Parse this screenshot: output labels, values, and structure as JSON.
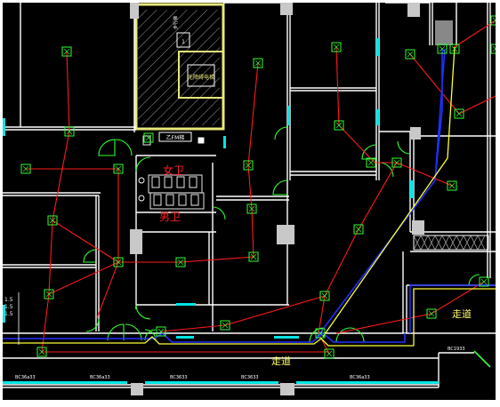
{
  "drawing": {
    "label_wc_female": "女卫",
    "label_wc_male": "男卫",
    "label_corridor_right": "走道",
    "label_corridor_bottom": "走道",
    "label_elevator": "无障碍电梯",
    "label_stair_top": "步行梯",
    "label_stair_small": "1",
    "label_stair_bottom": "乙FM梯",
    "scale_marks": [
      "1.5",
      "1.5",
      "1.5"
    ],
    "door_tags": [
      "BC36a33",
      "BC36a33",
      "BC3633",
      "BC3633",
      "BC36a33"
    ],
    "door_tag_right": "BC1933"
  },
  "colors": {
    "background": "#000000",
    "walls": "#ffffff",
    "columns": "#c8c8c8",
    "detector_box": "#33ff33",
    "wiring_red": "#ff1a1a",
    "wiring_blue": "#2030ff",
    "wiring_yellow": "#ffff33",
    "door_arcs": "#33ff33",
    "windows": "#00e5e5",
    "stair_walls": "#e8e87a",
    "text_red": "#ff2020",
    "text_yellow": "#ffff66"
  }
}
